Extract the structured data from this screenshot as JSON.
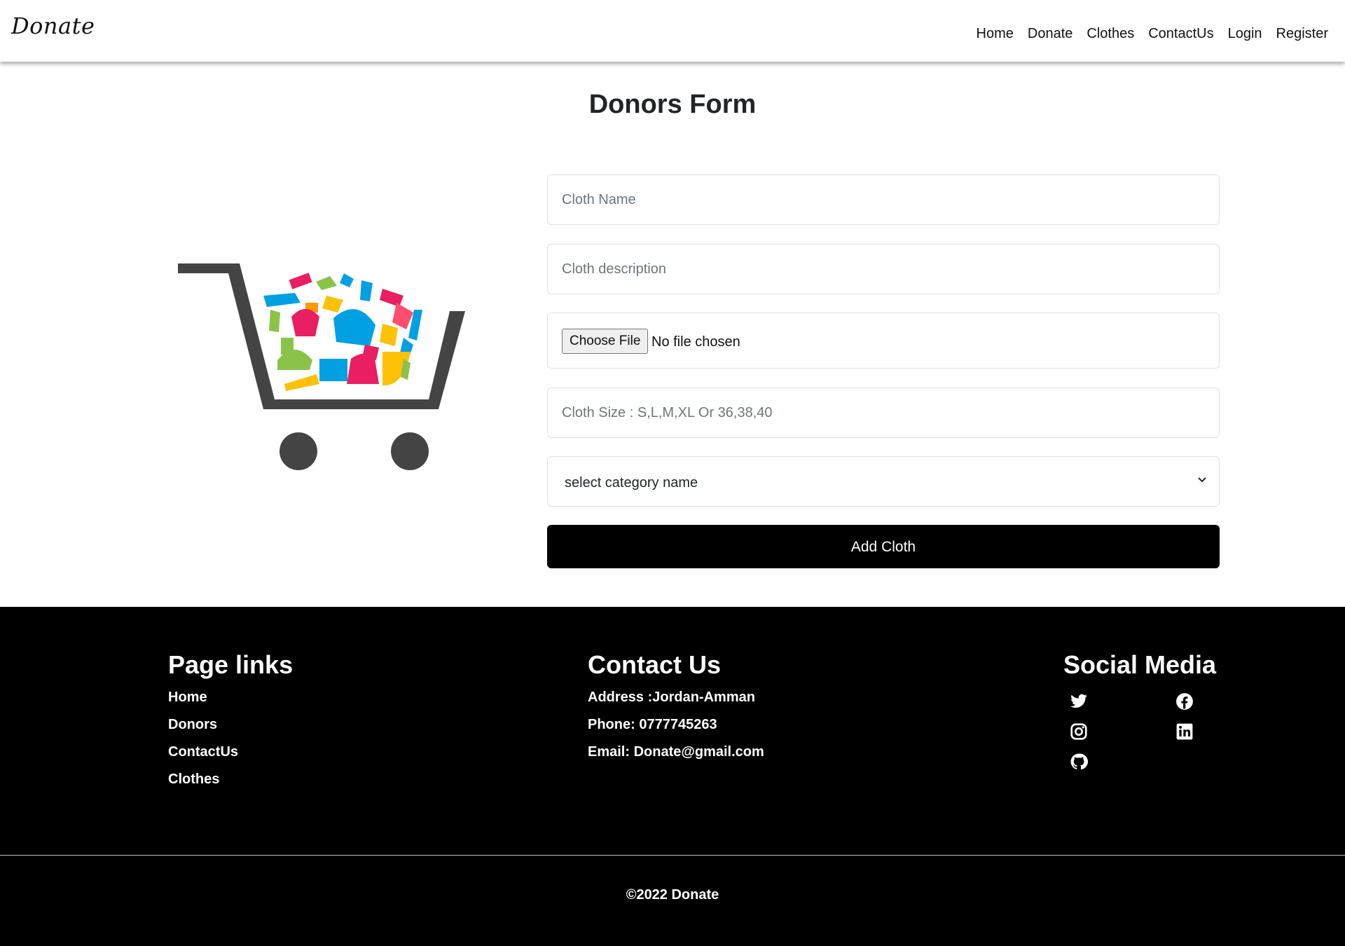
{
  "navbar": {
    "brand": "Donate",
    "links": [
      "Home",
      "Donate",
      "Clothes",
      "ContactUs",
      "Login",
      "Register"
    ]
  },
  "form": {
    "title": "Donors Form",
    "cloth_name_placeholder": "Cloth Name",
    "cloth_description_placeholder": "Cloth description",
    "file_button_label": "Choose File",
    "file_status": "No file chosen",
    "cloth_size_placeholder": "Cloth Size : S,L,M,XL Or 36,38,40",
    "category_select": "select category name",
    "submit_label": "Add Cloth"
  },
  "footer": {
    "page_links_title": "Page links",
    "page_links": [
      "Home",
      "Donors",
      "ContactUs",
      "Clothes"
    ],
    "contact_title": "Contact Us",
    "address": "Address :Jordan-Amman",
    "phone": "Phone: 0777745263",
    "email": "Email: Donate@gmail.com",
    "social_title": "Social Media",
    "social_icons": [
      "twitter-icon",
      "facebook-icon",
      "instagram-icon",
      "linkedin-icon",
      "github-icon"
    ],
    "copyright": "©2022 Donate"
  },
  "colors": {
    "footer_bg": "#000000",
    "button_bg": "#000000",
    "cart_color": "#444444"
  }
}
